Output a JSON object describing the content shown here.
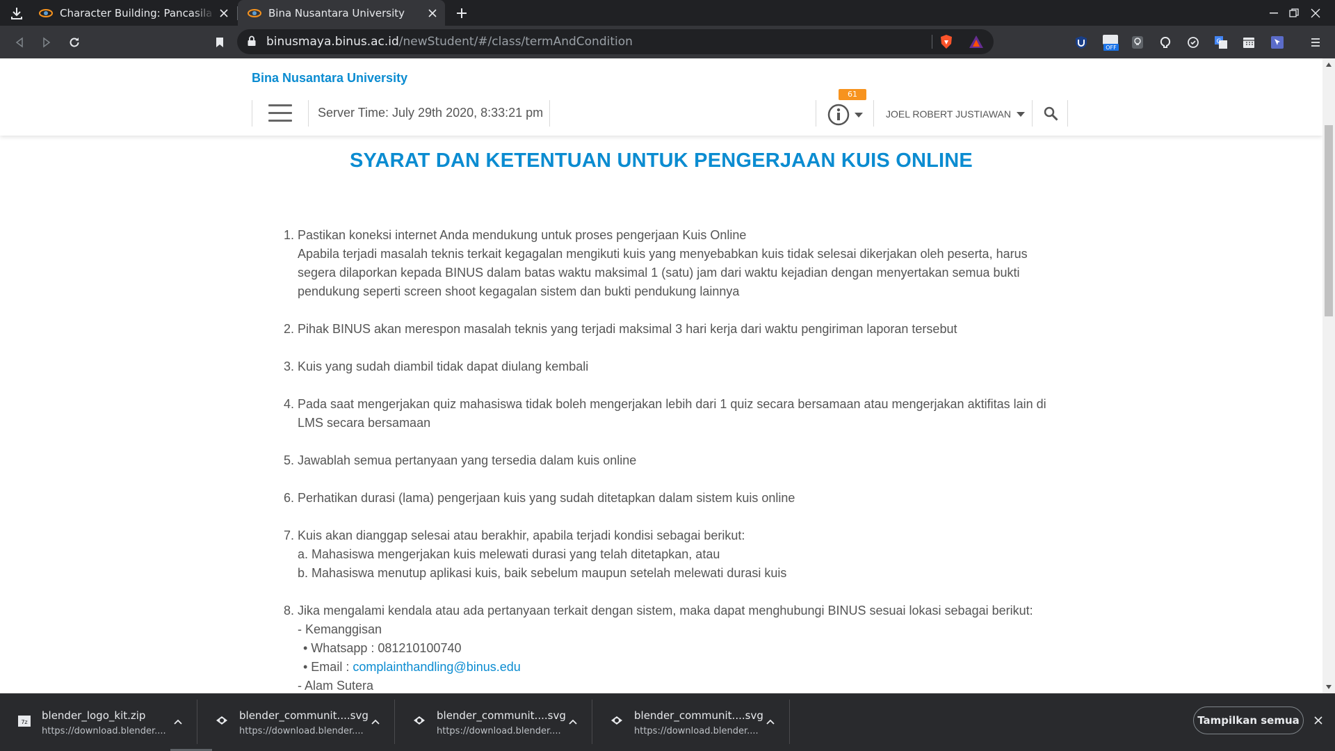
{
  "browser": {
    "tabs": [
      {
        "title": "Character Building: Pancasila - Binus",
        "active": false
      },
      {
        "title": "Bina Nusantara University",
        "active": true
      }
    ],
    "url_host": "binusmaya.binus.ac.id",
    "url_path": "/newStudent/#/class/termAndCondition",
    "extensions": [
      "ublock-icon",
      "off-badge-icon",
      "lightbulb-icon",
      "github-icon",
      "clock-icon",
      "translate-icon",
      "calendar-icon",
      "cursor-icon"
    ],
    "extension_off_label": "OFF"
  },
  "header": {
    "brand": "Bina Nusantara University",
    "server_time": "Server Time: July 29th 2020, 8:33:21 pm",
    "notification_count": "61",
    "user_name": "JOEL ROBERT JUSTIAWAN"
  },
  "page": {
    "title": "SYARAT DAN KETENTUAN UNTUK PENGERJAAN KUIS ONLINE",
    "terms": [
      {
        "num": "1.",
        "lines": [
          "Pastikan koneksi internet Anda mendukung untuk proses pengerjaan Kuis Online",
          "Apabila terjadi masalah teknis terkait kegagalan mengikuti kuis yang menyebabkan kuis tidak selesai dikerjakan oleh peserta, harus segera dilaporkan kepada BINUS dalam batas waktu maksimal 1 (satu) jam dari waktu kejadian dengan menyertakan semua bukti pendukung seperti screen shoot kegagalan sistem dan bukti pendukung lainnya"
        ]
      },
      {
        "num": "2.",
        "lines": [
          "Pihak BINUS akan merespon masalah teknis yang terjadi maksimal 3 hari kerja dari waktu pengiriman laporan tersebut"
        ]
      },
      {
        "num": "3.",
        "lines": [
          "Kuis yang sudah diambil tidak dapat diulang kembali"
        ]
      },
      {
        "num": "4.",
        "lines": [
          "Pada saat mengerjakan quiz mahasiswa tidak boleh mengerjakan lebih dari 1 quiz secara bersamaan atau mengerjakan aktifitas lain di LMS secara bersamaan"
        ]
      },
      {
        "num": "5.",
        "lines": [
          "Jawablah semua pertanyaan yang tersedia dalam kuis online"
        ]
      },
      {
        "num": "6.",
        "lines": [
          "Perhatikan durasi (lama) pengerjaan kuis yang sudah ditetapkan dalam sistem kuis online"
        ]
      },
      {
        "num": "7.",
        "lines": [
          "Kuis akan dianggap selesai atau berakhir, apabila terjadi kondisi sebagai berikut:",
          "a. Mahasiswa mengerjakan kuis melewati durasi yang telah ditetapkan, atau",
          "b. Mahasiswa menutup aplikasi kuis, baik sebelum maupun setelah melewati durasi kuis"
        ]
      }
    ],
    "term8": {
      "num": "8.",
      "intro": "Jika mengalami kendala atau ada pertanyaan terkait dengan sistem, maka dapat menghubungi BINUS sesuai lokasi sebagai berikut:",
      "loc1": "- Kemanggisan",
      "whatsapp": "• Whatsapp : 081210100740",
      "email_label": "• Email : ",
      "email": "complainthandling@binus.edu",
      "loc2": "- Alam Sutera"
    }
  },
  "downloads": {
    "items": [
      {
        "name": "blender_logo_kit.zip",
        "source": "https://download.blender...."
      },
      {
        "name": "blender_communit....svg",
        "source": "https://download.blender...."
      },
      {
        "name": "blender_communit....svg",
        "source": "https://download.blender...."
      },
      {
        "name": "blender_communit....svg",
        "source": "https://download.blender...."
      }
    ],
    "show_all": "Tampilkan semua"
  },
  "colors": {
    "accent": "#0b8cd1",
    "badge": "#f7931e",
    "chrome_dark": "#202124",
    "chrome_mid": "#35363a"
  }
}
